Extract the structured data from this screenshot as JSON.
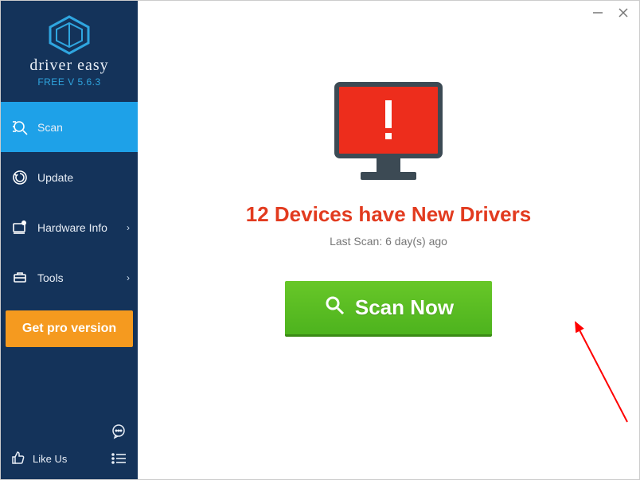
{
  "brand": {
    "name": "driver easy",
    "version": "FREE V 5.6.3"
  },
  "sidebar": {
    "items": [
      {
        "label": "Scan",
        "icon": "scan-icon",
        "active": true,
        "chevron": false
      },
      {
        "label": "Update",
        "icon": "update-icon",
        "active": false,
        "chevron": false
      },
      {
        "label": "Hardware Info",
        "icon": "hardware-info-icon",
        "active": false,
        "chevron": true
      },
      {
        "label": "Tools",
        "icon": "tools-icon",
        "active": false,
        "chevron": true
      }
    ],
    "get_pro_label": "Get pro version",
    "like_us_label": "Like Us"
  },
  "main": {
    "headline": "12 Devices have New Drivers",
    "last_scan": "Last Scan: 6 day(s) ago",
    "scan_button_label": "Scan Now"
  },
  "colors": {
    "sidebar_bg": "#14335a",
    "accent_blue": "#1ea1e8",
    "alert_red": "#e23b1f",
    "scan_green": "#4db31e",
    "pro_orange": "#f59a1f"
  }
}
